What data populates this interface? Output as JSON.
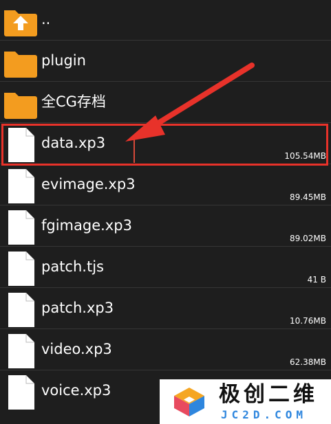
{
  "file_list": {
    "items": [
      {
        "name": "..",
        "kind": "parent-folder",
        "icon": "folder-up-icon",
        "size": ""
      },
      {
        "name": "plugin",
        "kind": "folder",
        "icon": "folder-icon",
        "size": ""
      },
      {
        "name": "全CG存档",
        "kind": "folder",
        "icon": "folder-icon",
        "size": ""
      },
      {
        "name": "data.xp3",
        "kind": "file",
        "icon": "file-icon",
        "size": "105.54MB"
      },
      {
        "name": "evimage.xp3",
        "kind": "file",
        "icon": "file-icon",
        "size": "89.45MB"
      },
      {
        "name": "fgimage.xp3",
        "kind": "file",
        "icon": "file-icon",
        "size": "89.02MB"
      },
      {
        "name": "patch.tjs",
        "kind": "file",
        "icon": "file-icon",
        "size": "41 B"
      },
      {
        "name": "patch.xp3",
        "kind": "file",
        "icon": "file-icon",
        "size": "10.76MB"
      },
      {
        "name": "video.xp3",
        "kind": "file",
        "icon": "file-icon",
        "size": "62.38MB"
      },
      {
        "name": "voice.xp3",
        "kind": "file",
        "icon": "file-icon",
        "size": ""
      }
    ]
  },
  "annotation": {
    "highlighted_item": "data.xp3",
    "highlight_color": "#e8322a",
    "arrow_color": "#e8322a"
  },
  "watermark": {
    "brand": "极创二维",
    "domain": "JC2D.COM"
  },
  "colors": {
    "background": "#1e1e1e",
    "folder": "#f39c1f",
    "file": "#ffffff"
  }
}
